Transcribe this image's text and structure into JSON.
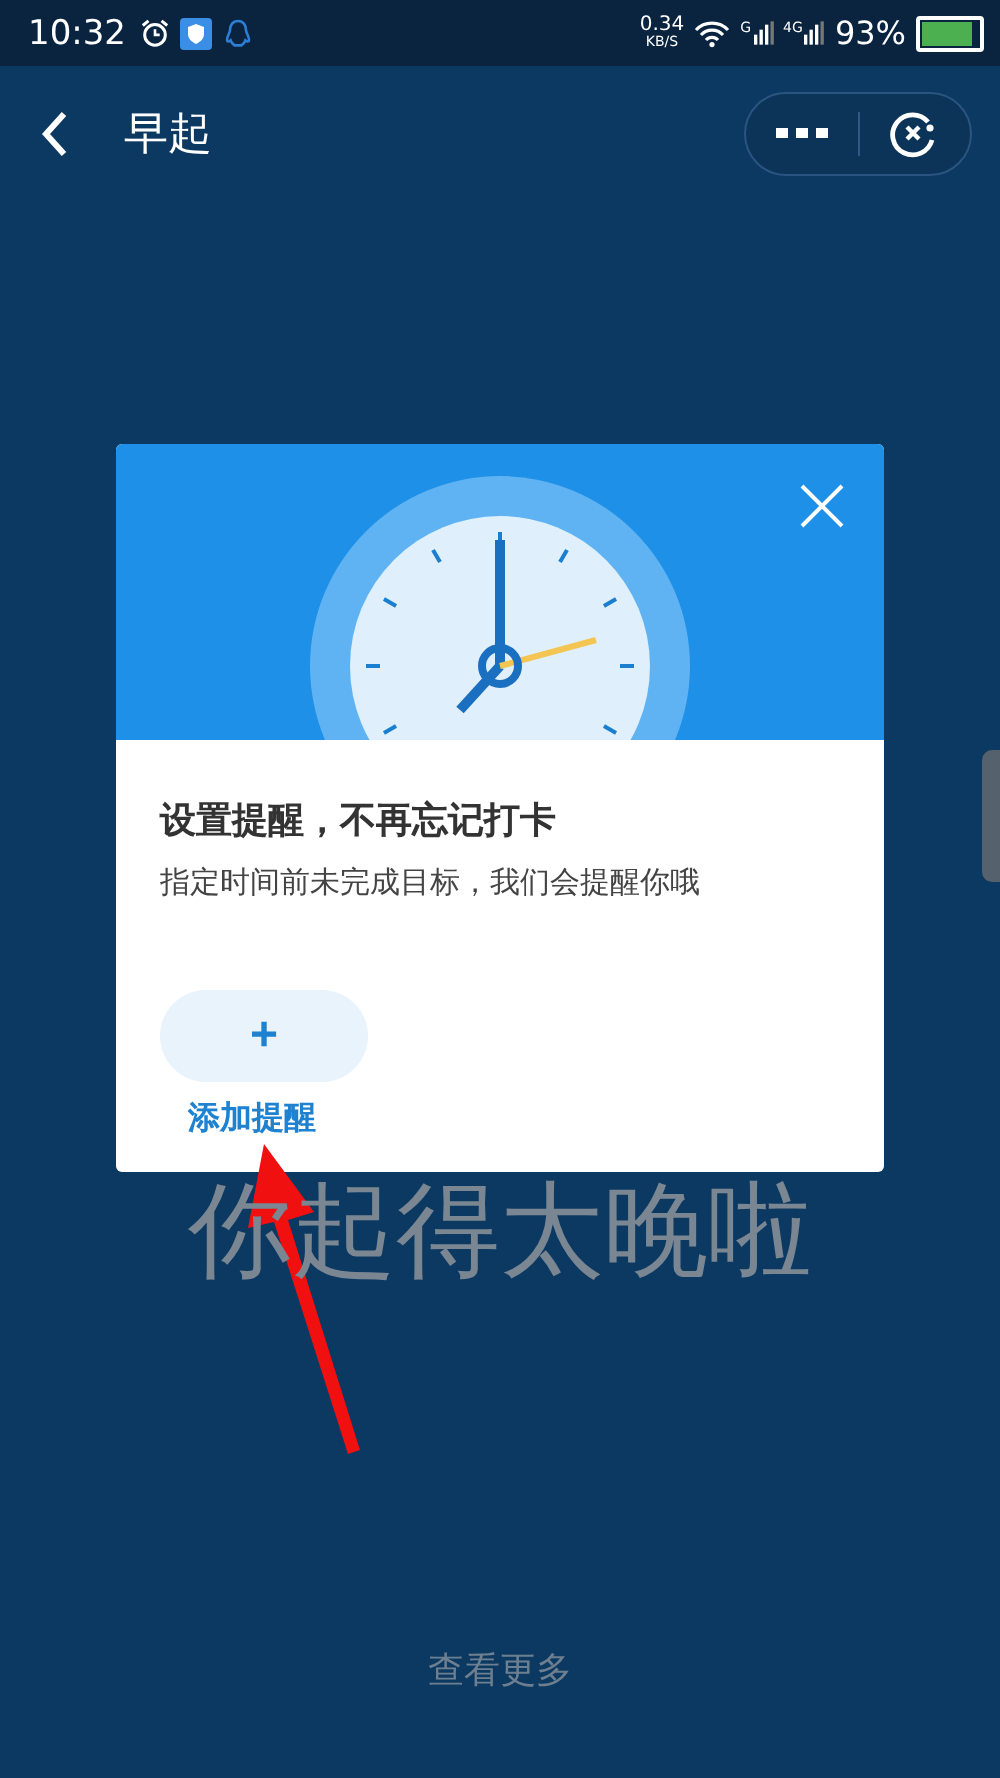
{
  "status_bar": {
    "time": "10:32",
    "speed_value": "0.34",
    "speed_unit": "KB/S",
    "signal_labels": [
      "G",
      "4G"
    ],
    "battery_percent": "93%"
  },
  "nav_bar": {
    "title": "早起"
  },
  "background_text": "你起得太晚啦",
  "dialog": {
    "title": "设置提醒，不再忘记打卡",
    "subtitle": "指定时间前未完成目标，我们会提醒你哦",
    "add_button": {
      "icon": "+",
      "label": "添加提醒"
    }
  },
  "footer_link": "查看更多"
}
